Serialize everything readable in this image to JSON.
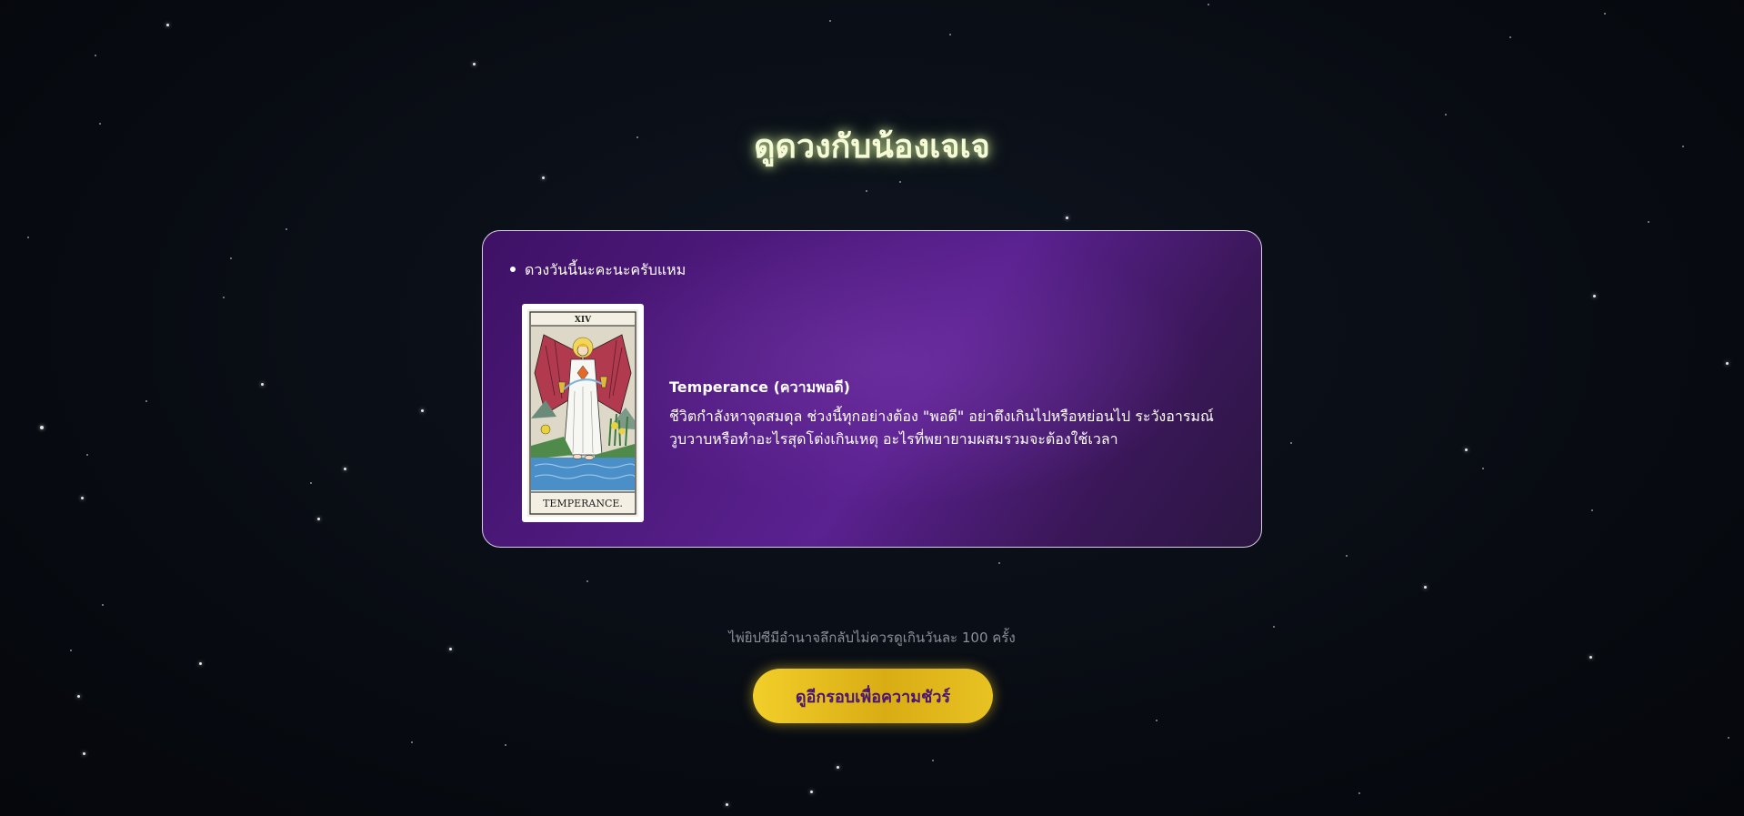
{
  "page": {
    "title": "ดูดวงกับน้องเจเจ"
  },
  "card": {
    "bullet_text": "ดวงวันนี้นะคะนะครับแหม",
    "tarot": {
      "numeral": "XIV",
      "caption": "TEMPERANCE."
    },
    "reading_title": "Temperance (ความพอดี)",
    "reading_text": "ชีวิตกำลังหาจุดสมดุล ช่วงนี้ทุกอย่างต้อง \"พอดี\" อย่าตึงเกินไปหรือหย่อนไป ระวังอารมณ์วูบวาบหรือทำอะไรสุดโต่งเกินเหตุ อะไรที่พยายามผสมรวมจะต้องใช้เวลา"
  },
  "footer": {
    "limit_note": "ไพ่ยิปซีมีอำนาจลึกลับไม่ควรดูเกินวันละ 100 ครั้ง",
    "again_button": "ดูอีกรอบเพื่อความชัวร์"
  },
  "colors": {
    "accent_gold": "#f2cf2a",
    "card_purple": "#5a2190",
    "title_glow": "#f4fbd6",
    "button_text": "#4a1573"
  }
}
